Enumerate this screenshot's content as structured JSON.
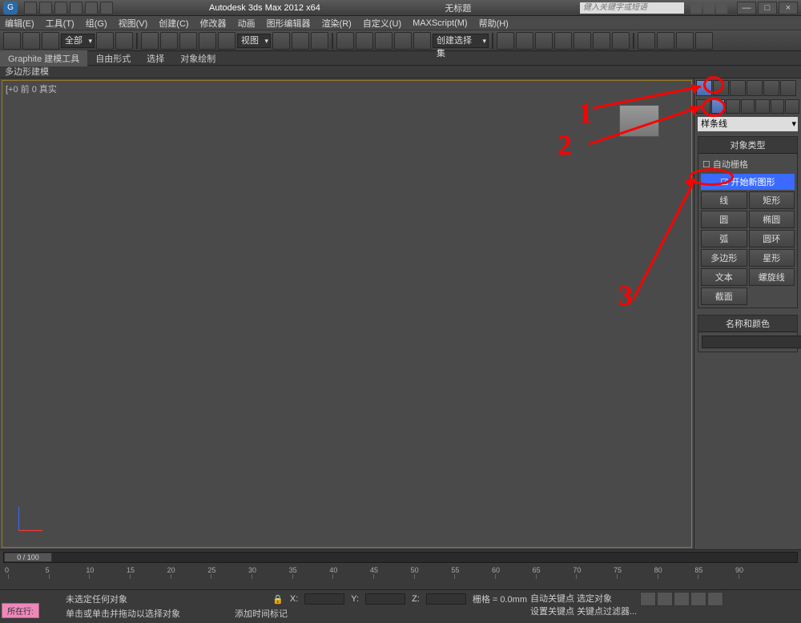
{
  "titlebar": {
    "app_title": "Autodesk 3ds Max 2012 x64",
    "doc_title": "无标题",
    "search_placeholder": "健入关键字或短语",
    "min": "—",
    "max": "□",
    "close": "×"
  },
  "menubar": {
    "items": [
      "编辑(E)",
      "工具(T)",
      "组(G)",
      "视图(V)",
      "创建(C)",
      "修改器",
      "动画",
      "图形编辑器",
      "渲染(R)",
      "自定义(U)",
      "MAXScript(M)",
      "帮助(H)"
    ]
  },
  "toolbar": {
    "combo_all": "全部",
    "combo_view": "视图",
    "combo_create_select": "创建选择集"
  },
  "ribbon": {
    "tabs": [
      "Graphite 建模工具",
      "自由形式",
      "选择",
      "对象绘制"
    ],
    "sub": "多边形建模"
  },
  "viewport": {
    "label": "[+0 前 0 真实"
  },
  "cmd_panel": {
    "dropdown": "样条线",
    "rollout_object_type": "对象类型",
    "auto_grid": "自动栅格",
    "start_new_shape": "开始新图形",
    "buttons": [
      [
        "线",
        "矩形"
      ],
      [
        "圆",
        "椭圆"
      ],
      [
        "弧",
        "圆环"
      ],
      [
        "多边形",
        "星形"
      ],
      [
        "文本",
        "螺旋线"
      ],
      [
        "截面",
        ""
      ]
    ],
    "rollout_name_color": "名称和颜色"
  },
  "timeline": {
    "slider": "0 / 100",
    "ticks": [
      0,
      5,
      10,
      15,
      20,
      25,
      30,
      35,
      40,
      45,
      50,
      55,
      60,
      65,
      70,
      75,
      80,
      85,
      90
    ]
  },
  "statusbar": {
    "pink_btn": "所在行:",
    "no_selection": "未选定任何对象",
    "click_hint": "单击或单击并拖动以选择对象",
    "add_time_tag": "添加时间标记",
    "x_label": "X:",
    "y_label": "Y:",
    "z_label": "Z:",
    "grid_label": "栅格 = 0.0mm",
    "auto_key": "自动关键点",
    "set_key": "设置关键点",
    "selected_obj": "选定对象",
    "key_filters": "关键点过滤器..."
  },
  "annotations": {
    "n1": "1",
    "n2": "2",
    "n3": "3"
  }
}
